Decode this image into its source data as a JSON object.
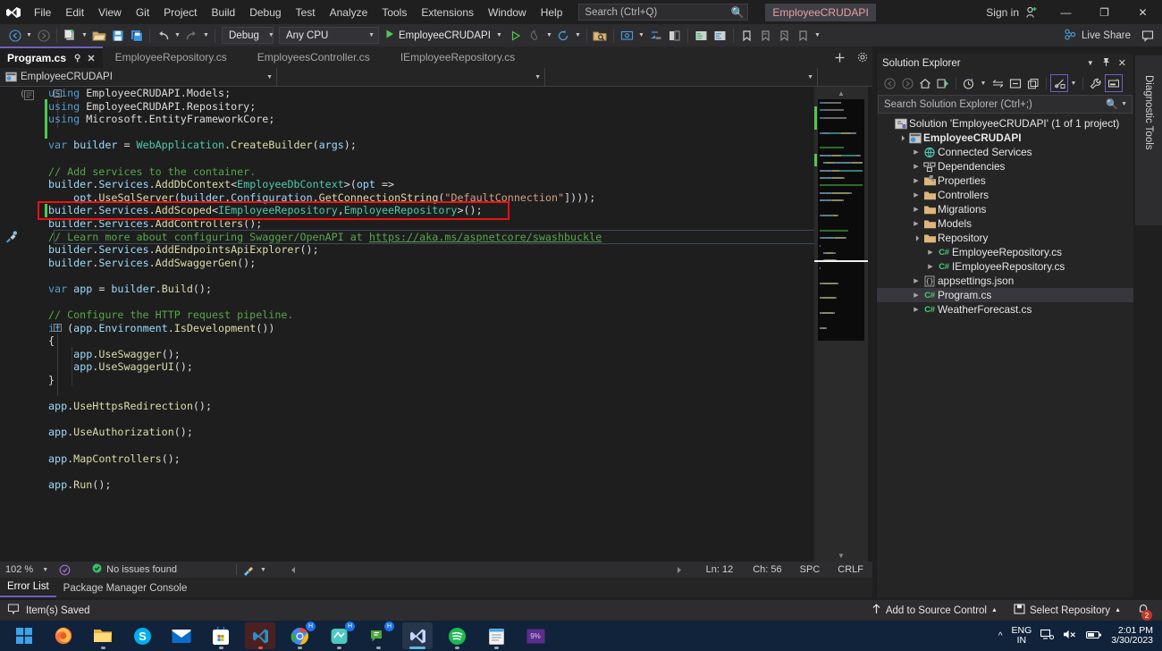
{
  "window": {
    "app_title": "EmployeeCRUDAPI",
    "sign_in": "Sign in",
    "minimize": "—",
    "restore": "❐",
    "close": "✕"
  },
  "menu": {
    "items": [
      "File",
      "Edit",
      "View",
      "Git",
      "Project",
      "Build",
      "Debug",
      "Test",
      "Analyze",
      "Tools",
      "Extensions",
      "Window",
      "Help"
    ],
    "search_placeholder": "Search (Ctrl+Q)",
    "search_value": ""
  },
  "toolbar": {
    "configuration": "Debug",
    "platform": "Any CPU",
    "run_target": "EmployeeCRUDAPI",
    "live_share": "Live Share"
  },
  "tabs": [
    {
      "label": "Program.cs",
      "active": true,
      "pin": "⚲",
      "close": "✕"
    },
    {
      "label": "EmployeeRepository.cs",
      "active": false
    },
    {
      "label": "EmployeesController.cs",
      "active": false
    },
    {
      "label": "IEmployeeRepository.cs",
      "active": false
    }
  ],
  "navbar": {
    "project": "EmployeeCRUDAPI",
    "type": "",
    "member": ""
  },
  "code_lines": [
    {
      "indent": 0,
      "tokens": [
        [
          "kw",
          "using "
        ],
        [
          "pln",
          "EmployeeCRUDAPI"
        ],
        [
          "pln",
          "."
        ],
        [
          "pln",
          "Models"
        ],
        [
          "pln",
          ";"
        ]
      ]
    },
    {
      "indent": 0,
      "tokens": [
        [
          "kw",
          "using "
        ],
        [
          "pln",
          "EmployeeCRUDAPI"
        ],
        [
          "pln",
          "."
        ],
        [
          "pln",
          "Repository"
        ],
        [
          "pln",
          ";"
        ]
      ]
    },
    {
      "indent": 0,
      "tokens": [
        [
          "kw",
          "using "
        ],
        [
          "pln",
          "Microsoft"
        ],
        [
          "pln",
          "."
        ],
        [
          "pln",
          "EntityFrameworkCore"
        ],
        [
          "pln",
          ";"
        ]
      ]
    },
    {
      "indent": 0,
      "tokens": []
    },
    {
      "indent": 0,
      "tokens": [
        [
          "kw",
          "var "
        ],
        [
          "var",
          "builder "
        ],
        [
          "pln",
          "= "
        ],
        [
          "typ",
          "WebApplication"
        ],
        [
          "pln",
          "."
        ],
        [
          "mth",
          "CreateBuilder"
        ],
        [
          "pln",
          "("
        ],
        [
          "var",
          "args"
        ],
        [
          "pln",
          ");"
        ]
      ]
    },
    {
      "indent": 0,
      "tokens": []
    },
    {
      "indent": 0,
      "tokens": [
        [
          "cmt",
          "// Add services to the container."
        ]
      ]
    },
    {
      "indent": 0,
      "tokens": [
        [
          "var",
          "builder"
        ],
        [
          "pln",
          "."
        ],
        [
          "var",
          "Services"
        ],
        [
          "pln",
          "."
        ],
        [
          "mth",
          "AddDbContext"
        ],
        [
          "pln",
          "<"
        ],
        [
          "typ",
          "EmployeeDbContext"
        ],
        [
          "pln",
          ">("
        ],
        [
          "var",
          "opt "
        ],
        [
          "pln",
          "=>"
        ]
      ]
    },
    {
      "indent": 4,
      "tokens": [
        [
          "var",
          "opt"
        ],
        [
          "pln",
          "."
        ],
        [
          "mth",
          "UseSqlServer"
        ],
        [
          "pln",
          "("
        ],
        [
          "var",
          "builder"
        ],
        [
          "pln",
          "."
        ],
        [
          "var",
          "Configuration"
        ],
        [
          "pln",
          "."
        ],
        [
          "mth",
          "GetConnectionString"
        ],
        [
          "pln",
          "("
        ],
        [
          "str",
          "\"DefaultConnection\""
        ],
        [
          "pln",
          "])));"
        ]
      ]
    },
    {
      "indent": 0,
      "tokens": [
        [
          "var",
          "builder"
        ],
        [
          "pln",
          "."
        ],
        [
          "var",
          "Services"
        ],
        [
          "pln",
          "."
        ],
        [
          "mth",
          "AddScoped"
        ],
        [
          "pln",
          "<"
        ],
        [
          "typ",
          "IEmployeeRepository"
        ],
        [
          "pln",
          ","
        ],
        [
          "typ",
          "EmployeeRepository"
        ],
        [
          "pln",
          ">();"
        ]
      ]
    },
    {
      "indent": 0,
      "tokens": [
        [
          "var",
          "builder"
        ],
        [
          "pln",
          "."
        ],
        [
          "var",
          "Services"
        ],
        [
          "pln",
          "."
        ],
        [
          "mth",
          "AddControllers"
        ],
        [
          "pln",
          "();"
        ]
      ]
    },
    {
      "indent": 0,
      "tokens": [
        [
          "cmt",
          "// Learn more about configuring Swagger/OpenAPI at "
        ],
        [
          "lnk",
          "https://aka.ms/aspnetcore/swashbuckle"
        ]
      ]
    },
    {
      "indent": 0,
      "tokens": [
        [
          "var",
          "builder"
        ],
        [
          "pln",
          "."
        ],
        [
          "var",
          "Services"
        ],
        [
          "pln",
          "."
        ],
        [
          "mth",
          "AddEndpointsApiExplorer"
        ],
        [
          "pln",
          "();"
        ]
      ]
    },
    {
      "indent": 0,
      "tokens": [
        [
          "var",
          "builder"
        ],
        [
          "pln",
          "."
        ],
        [
          "var",
          "Services"
        ],
        [
          "pln",
          "."
        ],
        [
          "mth",
          "AddSwaggerGen"
        ],
        [
          "pln",
          "();"
        ]
      ]
    },
    {
      "indent": 0,
      "tokens": []
    },
    {
      "indent": 0,
      "tokens": [
        [
          "kw",
          "var "
        ],
        [
          "var",
          "app "
        ],
        [
          "pln",
          "= "
        ],
        [
          "var",
          "builder"
        ],
        [
          "pln",
          "."
        ],
        [
          "mth",
          "Build"
        ],
        [
          "pln",
          "();"
        ]
      ]
    },
    {
      "indent": 0,
      "tokens": []
    },
    {
      "indent": 0,
      "tokens": [
        [
          "cmt",
          "// Configure the HTTP request pipeline."
        ]
      ]
    },
    {
      "indent": 0,
      "tokens": [
        [
          "kw",
          "if "
        ],
        [
          "pln",
          "("
        ],
        [
          "var",
          "app"
        ],
        [
          "pln",
          "."
        ],
        [
          "var",
          "Environment"
        ],
        [
          "pln",
          "."
        ],
        [
          "mth",
          "IsDevelopment"
        ],
        [
          "pln",
          "())"
        ]
      ]
    },
    {
      "indent": 0,
      "tokens": [
        [
          "pln",
          "{"
        ]
      ]
    },
    {
      "indent": 4,
      "tokens": [
        [
          "var",
          "app"
        ],
        [
          "pln",
          "."
        ],
        [
          "mth",
          "UseSwagger"
        ],
        [
          "pln",
          "();"
        ]
      ]
    },
    {
      "indent": 4,
      "tokens": [
        [
          "var",
          "app"
        ],
        [
          "pln",
          "."
        ],
        [
          "mth",
          "UseSwaggerUI"
        ],
        [
          "pln",
          "();"
        ]
      ]
    },
    {
      "indent": 0,
      "tokens": [
        [
          "pln",
          "}"
        ]
      ]
    },
    {
      "indent": 0,
      "tokens": []
    },
    {
      "indent": 0,
      "tokens": [
        [
          "var",
          "app"
        ],
        [
          "pln",
          "."
        ],
        [
          "mth",
          "UseHttpsRedirection"
        ],
        [
          "pln",
          "();"
        ]
      ]
    },
    {
      "indent": 0,
      "tokens": []
    },
    {
      "indent": 0,
      "tokens": [
        [
          "var",
          "app"
        ],
        [
          "pln",
          "."
        ],
        [
          "mth",
          "UseAuthorization"
        ],
        [
          "pln",
          "();"
        ]
      ]
    },
    {
      "indent": 0,
      "tokens": []
    },
    {
      "indent": 0,
      "tokens": [
        [
          "var",
          "app"
        ],
        [
          "pln",
          "."
        ],
        [
          "mth",
          "MapControllers"
        ],
        [
          "pln",
          "();"
        ]
      ]
    },
    {
      "indent": 0,
      "tokens": []
    },
    {
      "indent": 0,
      "tokens": [
        [
          "var",
          "app"
        ],
        [
          "pln",
          "."
        ],
        [
          "mth",
          "Run"
        ],
        [
          "pln",
          "();"
        ]
      ]
    }
  ],
  "annotation": {
    "color": "#ee1111",
    "highlighted_line": "builder.Services.AddScoped<IEmployeeRepository,EmployeeRepository>();"
  },
  "editor_status": {
    "zoom": "102 %",
    "issues": "No issues found",
    "line": "Ln: 12",
    "column": "Ch: 56",
    "spaces": "SPC",
    "line_ending": "CRLF"
  },
  "dock_tabs": [
    {
      "label": "Error List",
      "selected": true
    },
    {
      "label": "Package Manager Console",
      "selected": false
    }
  ],
  "solution_explorer": {
    "title": "Solution Explorer",
    "search_placeholder": "Search Solution Explorer (Ctrl+;)",
    "search_value": "",
    "tree": [
      {
        "label": "Solution 'EmployeeCRUDAPI' (1 of 1 project)",
        "depth": 0,
        "arrow": "",
        "icon": "solution-icon",
        "bold": false,
        "selected": false
      },
      {
        "label": "EmployeeCRUDAPI",
        "depth": 1,
        "arrow": "▼",
        "icon": "project-icon",
        "bold": true,
        "selected": false
      },
      {
        "label": "Connected Services",
        "depth": 2,
        "arrow": "▶",
        "icon": "connected-services-icon",
        "bold": false,
        "selected": false
      },
      {
        "label": "Dependencies",
        "depth": 2,
        "arrow": "▶",
        "icon": "dependencies-icon",
        "bold": false,
        "selected": false
      },
      {
        "label": "Properties",
        "depth": 2,
        "arrow": "▶",
        "icon": "properties-folder-icon",
        "bold": false,
        "selected": false
      },
      {
        "label": "Controllers",
        "depth": 2,
        "arrow": "▶",
        "icon": "folder-icon",
        "bold": false,
        "selected": false
      },
      {
        "label": "Migrations",
        "depth": 2,
        "arrow": "▶",
        "icon": "folder-icon",
        "bold": false,
        "selected": false
      },
      {
        "label": "Models",
        "depth": 2,
        "arrow": "▶",
        "icon": "folder-icon",
        "bold": false,
        "selected": false
      },
      {
        "label": "Repository",
        "depth": 2,
        "arrow": "▼",
        "icon": "folder-icon",
        "bold": false,
        "selected": false
      },
      {
        "label": "EmployeeRepository.cs",
        "depth": 3,
        "arrow": "▶",
        "icon": "csharp-file-icon",
        "bold": false,
        "selected": false
      },
      {
        "label": "IEmployeeRepository.cs",
        "depth": 3,
        "arrow": "▶",
        "icon": "csharp-file-icon",
        "bold": false,
        "selected": false
      },
      {
        "label": "appsettings.json",
        "depth": 2,
        "arrow": "▶",
        "icon": "json-file-icon",
        "bold": false,
        "selected": false
      },
      {
        "label": "Program.cs",
        "depth": 2,
        "arrow": "▶",
        "icon": "csharp-file-icon",
        "bold": false,
        "selected": true
      },
      {
        "label": "WeatherForecast.cs",
        "depth": 2,
        "arrow": "▶",
        "icon": "csharp-file-icon",
        "bold": false,
        "selected": false
      }
    ]
  },
  "diagnostic_tools": {
    "label": "Diagnostic Tools"
  },
  "status_bar": {
    "message": "Item(s) Saved",
    "add_to_source_control": "Add to Source Control",
    "select_repository": "Select Repository",
    "notification_count": "2"
  },
  "taskbar": {
    "apps": [
      "start-icon",
      "firefox-icon",
      "file-explorer-icon",
      "skype-icon",
      "mail-icon",
      "microsoft-store-icon",
      "vscode-icon",
      "chrome-icon",
      "teams-personal-icon",
      "whatsapp-icon",
      "visual-studio-icon",
      "spotify-icon",
      "notepad-icon",
      "app-icon"
    ],
    "language": "ENG",
    "region": "IN",
    "time": "2:01 PM",
    "date": "3/30/2023"
  },
  "colors": {
    "accent_purple": "#6f5fc2",
    "annotation_red": "#ee1111",
    "taskbar_bg": "#11233a",
    "chrome_bg": "#2d2d30",
    "editor_bg": "#1e1e1e"
  }
}
